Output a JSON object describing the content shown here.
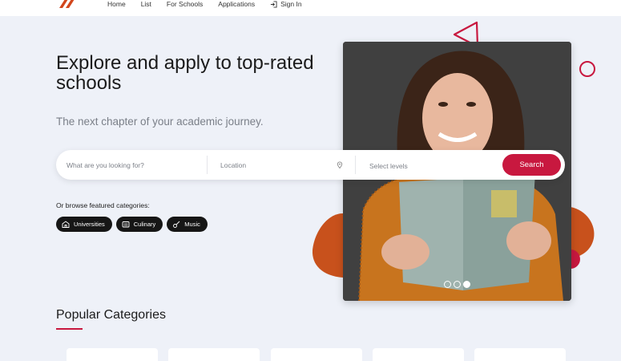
{
  "nav": {
    "items": [
      "Home",
      "List",
      "For Schools",
      "Applications"
    ],
    "signin": "Sign In"
  },
  "hero": {
    "title": "Explore and apply to top-rated schools",
    "subtitle": "The next chapter of your academic journey."
  },
  "search": {
    "what_placeholder": "What are you looking for?",
    "location_placeholder": "Location",
    "levels_placeholder": "Select levels",
    "button": "Search"
  },
  "browse": {
    "label": "Or browse featured categories:",
    "chips": [
      "Universities",
      "Culinary",
      "Music"
    ]
  },
  "popular": {
    "title": "Popular Categories"
  },
  "colors": {
    "accent": "#c8183f",
    "orange": "#c8511c",
    "background": "#eef1f8"
  },
  "slider": {
    "total": 3,
    "active": 3
  }
}
